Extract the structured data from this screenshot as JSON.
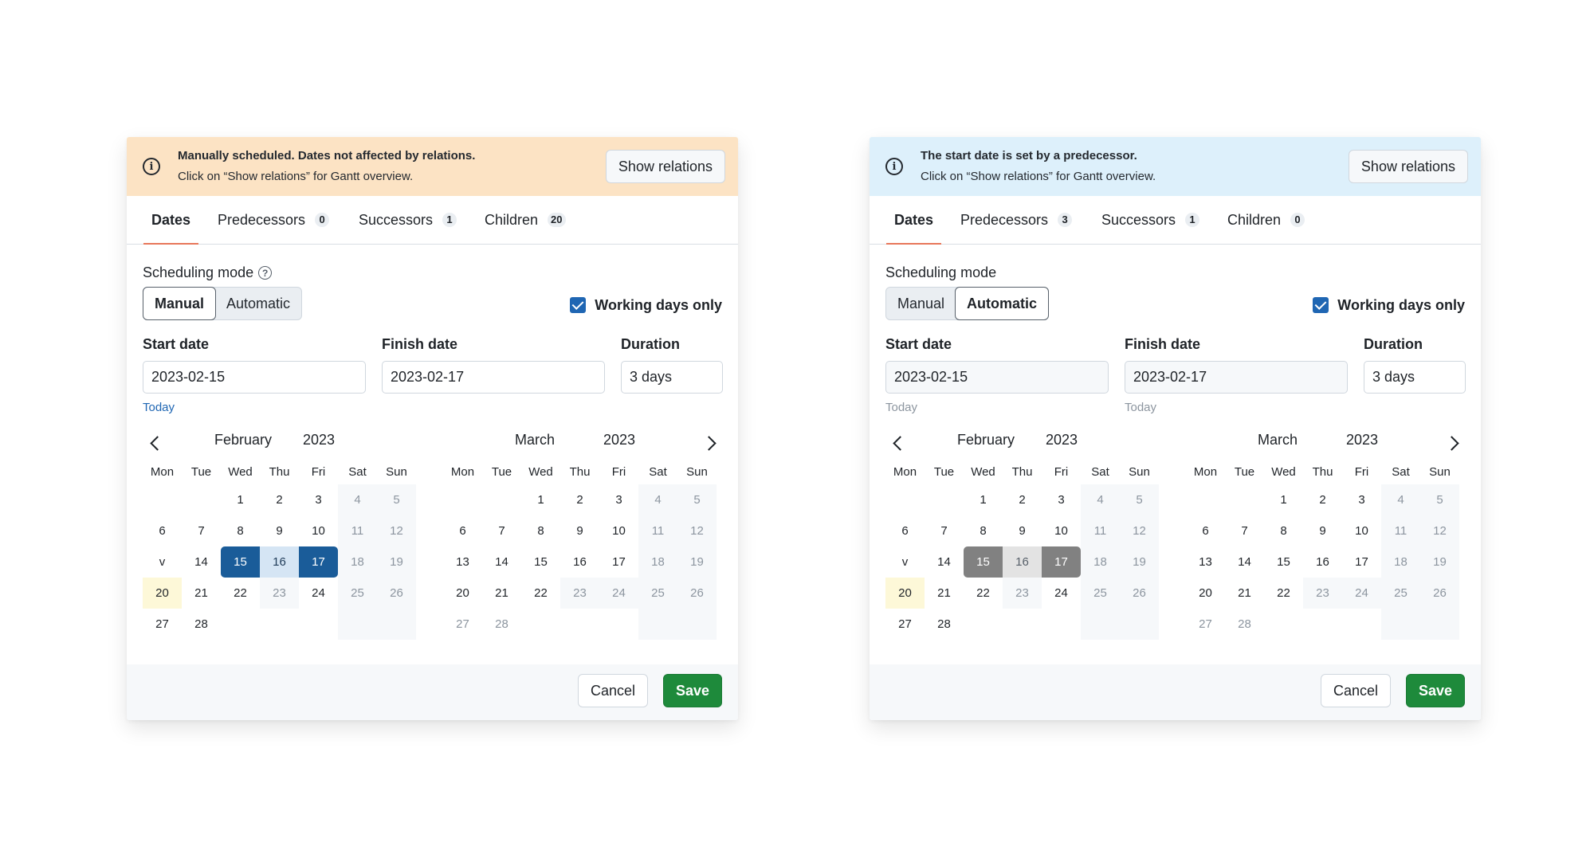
{
  "left": {
    "banner": {
      "title": "Manually scheduled. Dates not affected by relations.",
      "subtitle": "Click on “Show relations” for Gantt overview.",
      "button": "Show relations",
      "color": "#fce3c4"
    },
    "tabs": [
      {
        "label": "Dates",
        "count": ""
      },
      {
        "label": "Predecessors",
        "count": "0"
      },
      {
        "label": "Successors",
        "count": "1"
      },
      {
        "label": "Children",
        "count": "20"
      }
    ],
    "scheduling_label": "Scheduling mode",
    "help_icon": "?",
    "modes": [
      "Manual",
      "Automatic"
    ],
    "selected_mode": "Manual",
    "working_days_label": "Working days only",
    "working_days_checked": true,
    "start_label": "Start date",
    "start_value": "2023-02-15",
    "finish_label": "Finish date",
    "finish_value": "2023-02-17",
    "duration_label": "Duration",
    "duration_value": "3 days",
    "today_label": "Today",
    "today_muted": false,
    "cancel": "Cancel",
    "save": "Save"
  },
  "right": {
    "banner": {
      "title": "The start date is set by a predecessor.",
      "subtitle": "Click on “Show relations” for Gantt overview.",
      "button": "Show relations",
      "color": "#ddf0fb"
    },
    "tabs": [
      {
        "label": "Dates",
        "count": ""
      },
      {
        "label": "Predecessors",
        "count": "3"
      },
      {
        "label": "Successors",
        "count": "1"
      },
      {
        "label": "Children",
        "count": "0"
      }
    ],
    "scheduling_label": "Scheduling mode",
    "modes": [
      "Manual",
      "Automatic"
    ],
    "selected_mode": "Automatic",
    "working_days_label": "Working days only",
    "working_days_checked": true,
    "start_label": "Start date",
    "start_value": "2023-02-15",
    "finish_label": "Finish date",
    "finish_value": "2023-02-17",
    "duration_label": "Duration",
    "duration_value": "3 days",
    "today_label": "Today",
    "today_muted": true,
    "cancel": "Cancel",
    "save": "Save"
  },
  "calendar": {
    "weekdays": [
      "Mon",
      "Tue",
      "Wed",
      "Thu",
      "Fri",
      "Sat",
      "Sun"
    ],
    "months": [
      {
        "month": "February",
        "year": "2023",
        "weeks": [
          [
            "",
            "",
            "1",
            "2",
            "3",
            "4",
            "5"
          ],
          [
            "6",
            "7",
            "8",
            "9",
            "10",
            "11",
            "12"
          ],
          [
            "v",
            "14",
            "15",
            "16",
            "17",
            "18",
            "19"
          ],
          [
            "20",
            "21",
            "22",
            "23",
            "24",
            "25",
            "26"
          ],
          [
            "27",
            "28",
            "",
            "",
            "",
            "",
            ""
          ]
        ]
      },
      {
        "month": "March",
        "year": "2023",
        "weeks": [
          [
            "",
            "",
            "1",
            "2",
            "3",
            "4",
            "5"
          ],
          [
            "6",
            "7",
            "8",
            "9",
            "10",
            "11",
            "12"
          ],
          [
            "13",
            "14",
            "15",
            "16",
            "17",
            "18",
            "19"
          ],
          [
            "20",
            "21",
            "22",
            "23",
            "24",
            "25",
            "26"
          ],
          [
            "27",
            "28",
            "",
            "",
            "",
            "",
            ""
          ]
        ]
      }
    ],
    "today": "20",
    "range_start": "15",
    "range_mid": "16",
    "range_end": "17",
    "selected_color": "#1a5c99",
    "readonly_selected_color": "#818181",
    "today_highlight": "#fdf8d8"
  },
  "colors": {
    "save": "#1e8a3b",
    "tab_indicator": "#e8775a",
    "checkbox": "#1f66b3",
    "link": "#1f66b3"
  }
}
